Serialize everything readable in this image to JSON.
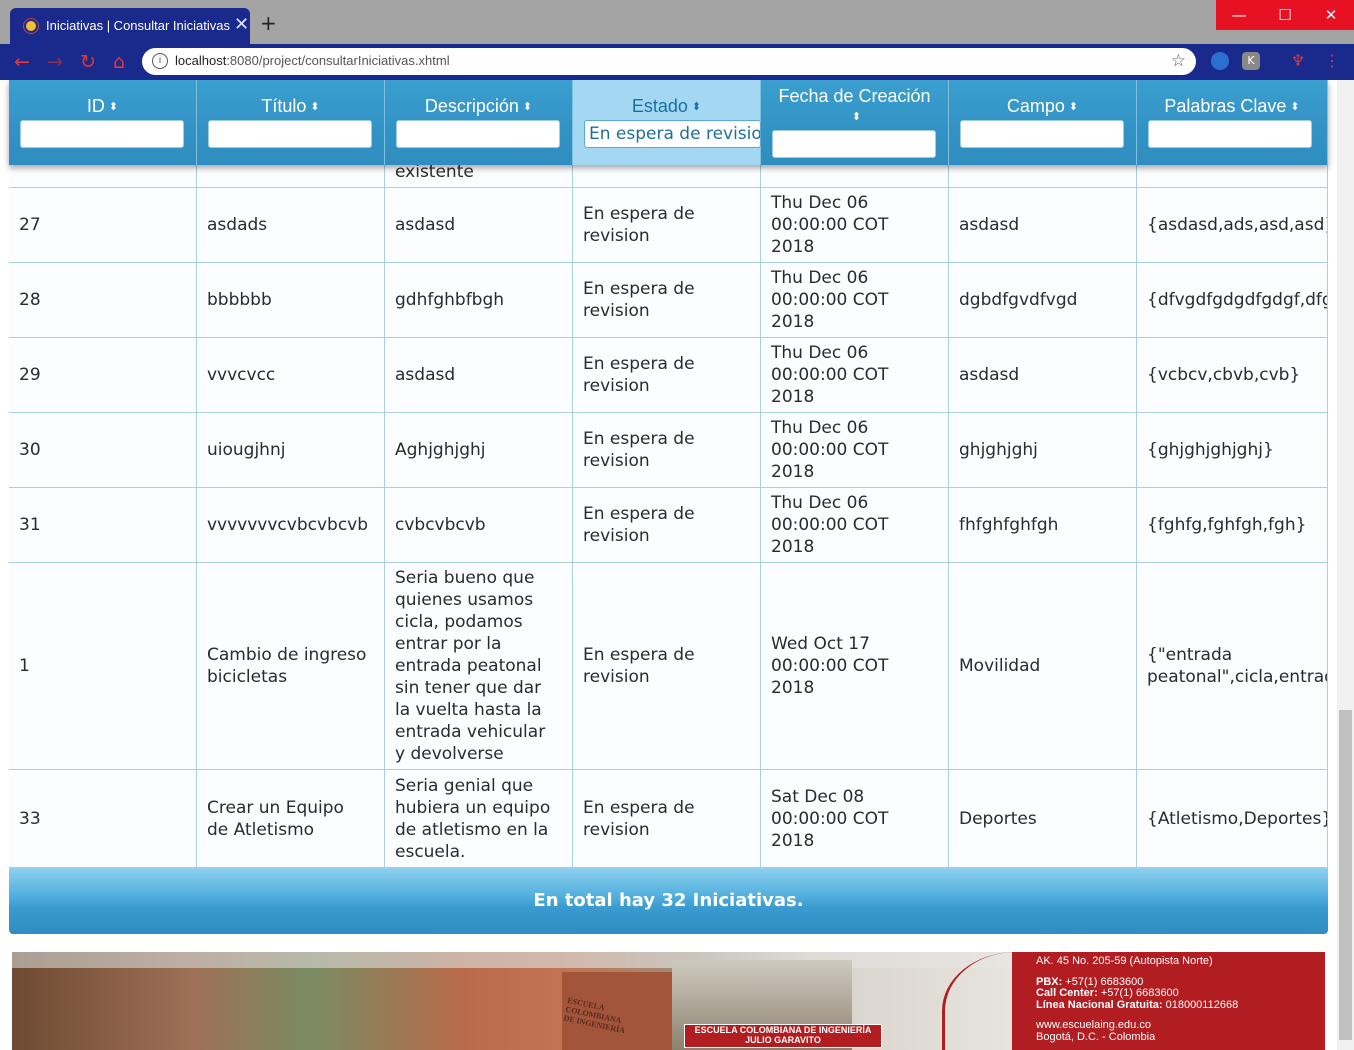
{
  "browser": {
    "tab_title": "Iniciativas | Consultar Iniciativas",
    "tab_close": "✕",
    "new_tab": "+",
    "url_host": "localhost",
    "url_rest": ":8080/project/consultarIniciativas.xhtml",
    "window_buttons": {
      "minimize": "—",
      "maximize": "☐",
      "close": "✕"
    }
  },
  "table": {
    "headers": [
      {
        "label": "ID",
        "sortable": true
      },
      {
        "label": "Título",
        "sortable": true
      },
      {
        "label": "Descripción",
        "sortable": true
      },
      {
        "label": "Estado",
        "sortable": true
      },
      {
        "label": "Fecha de Creación",
        "sortable": true
      },
      {
        "label": "Campo",
        "sortable": true
      },
      {
        "label": "Palabras Clave",
        "sortable": true
      }
    ],
    "sort_icon": "⬍",
    "estado_filter_value": "En espera de revision",
    "partial_row_text": "existente",
    "rows": [
      {
        "id": "27",
        "titulo": "asdads",
        "descripcion": "asdasd",
        "estado": "En espera de\nrevision",
        "fecha": "Thu Dec 06\n00:00:00 COT\n2018",
        "campo": "asdasd",
        "palabras": "{asdasd,ads,asd,asd}"
      },
      {
        "id": "28",
        "titulo": "bbbbbb",
        "descripcion": "gdhfghbfbgh",
        "estado": "En espera de\nrevision",
        "fecha": "Thu Dec 06\n00:00:00 COT\n2018",
        "campo": "dgbdfgvdfvgd",
        "palabras": "{dfvgdfgdgdfgdgf,dfgdf}"
      },
      {
        "id": "29",
        "titulo": "vvvcvcc",
        "descripcion": "asdasd",
        "estado": "En espera de\nrevision",
        "fecha": "Thu Dec 06\n00:00:00 COT\n2018",
        "campo": "asdasd",
        "palabras": "{vcbcv,cbvb,cvb}"
      },
      {
        "id": "30",
        "titulo": "uiougjhnj",
        "descripcion": "Aghjghjghj",
        "estado": "En espera de\nrevision",
        "fecha": "Thu Dec 06\n00:00:00 COT\n2018",
        "campo": "ghjghjghj",
        "palabras": "{ghjghjghjghj}"
      },
      {
        "id": "31",
        "titulo": "vvvvvvvcvbcvbcvb",
        "descripcion": "cvbcvbcvb",
        "estado": "En espera de\nrevision",
        "fecha": "Thu Dec 06\n00:00:00 COT\n2018",
        "campo": "fhfghfghfgh",
        "palabras": "{fghfg,fghfgh,fgh}"
      },
      {
        "id": "1",
        "titulo": "Cambio de ingreso\nbicicletas",
        "descripcion": "Seria bueno que\nquienes usamos\ncicla, podamos\nentrar por la\nentrada peatonal\nsin tener que dar\nla vuelta hasta la\nentrada vehicular\ny devolverse",
        "estado": "En espera de\nrevision",
        "fecha": "Wed Oct 17\n00:00:00 COT\n2018",
        "campo": "Movilidad",
        "palabras": "{\"entrada\npeatonal\",cicla,entrada}"
      },
      {
        "id": "33",
        "titulo": "Crear un Equipo\nde Atletismo",
        "descripcion": "Seria genial que\nhubiera un equipo\nde atletismo en la\nescuela.",
        "estado": "En espera de\nrevision",
        "fecha": "Sat Dec 08\n00:00:00 COT\n2018",
        "campo": "Deportes",
        "palabras": "{Atletismo,Deportes}"
      }
    ],
    "footer": "En total hay 32 Iniciativas."
  },
  "banner": {
    "school_sign": "ESCUELA\nCOLOMBIANA\nDE INGENIERÍA",
    "logo_text": "ESCUELA COLOMBIANA DE INGENIERÍA\nJULIO GARAVITO",
    "address": "AK. 45 No. 205-59 (Autopista Norte)",
    "pbx_label": "PBX:",
    "pbx": "+57(1) 6683600",
    "callcenter_label": "Call Center:",
    "callcenter": "+57(1) 6683600",
    "linea_label": "Línea Nacional Gratuita:",
    "linea": "018000112668",
    "web": "www.escuelaing.edu.co",
    "city": "Bogotá, D.C. - Colombia"
  },
  "colors": {
    "header": "#3392c4",
    "active_header": "#a4d8f2",
    "border": "#a9cfe3",
    "browser_accent": "#1a2a8c",
    "banner_red": "#b21d21"
  }
}
